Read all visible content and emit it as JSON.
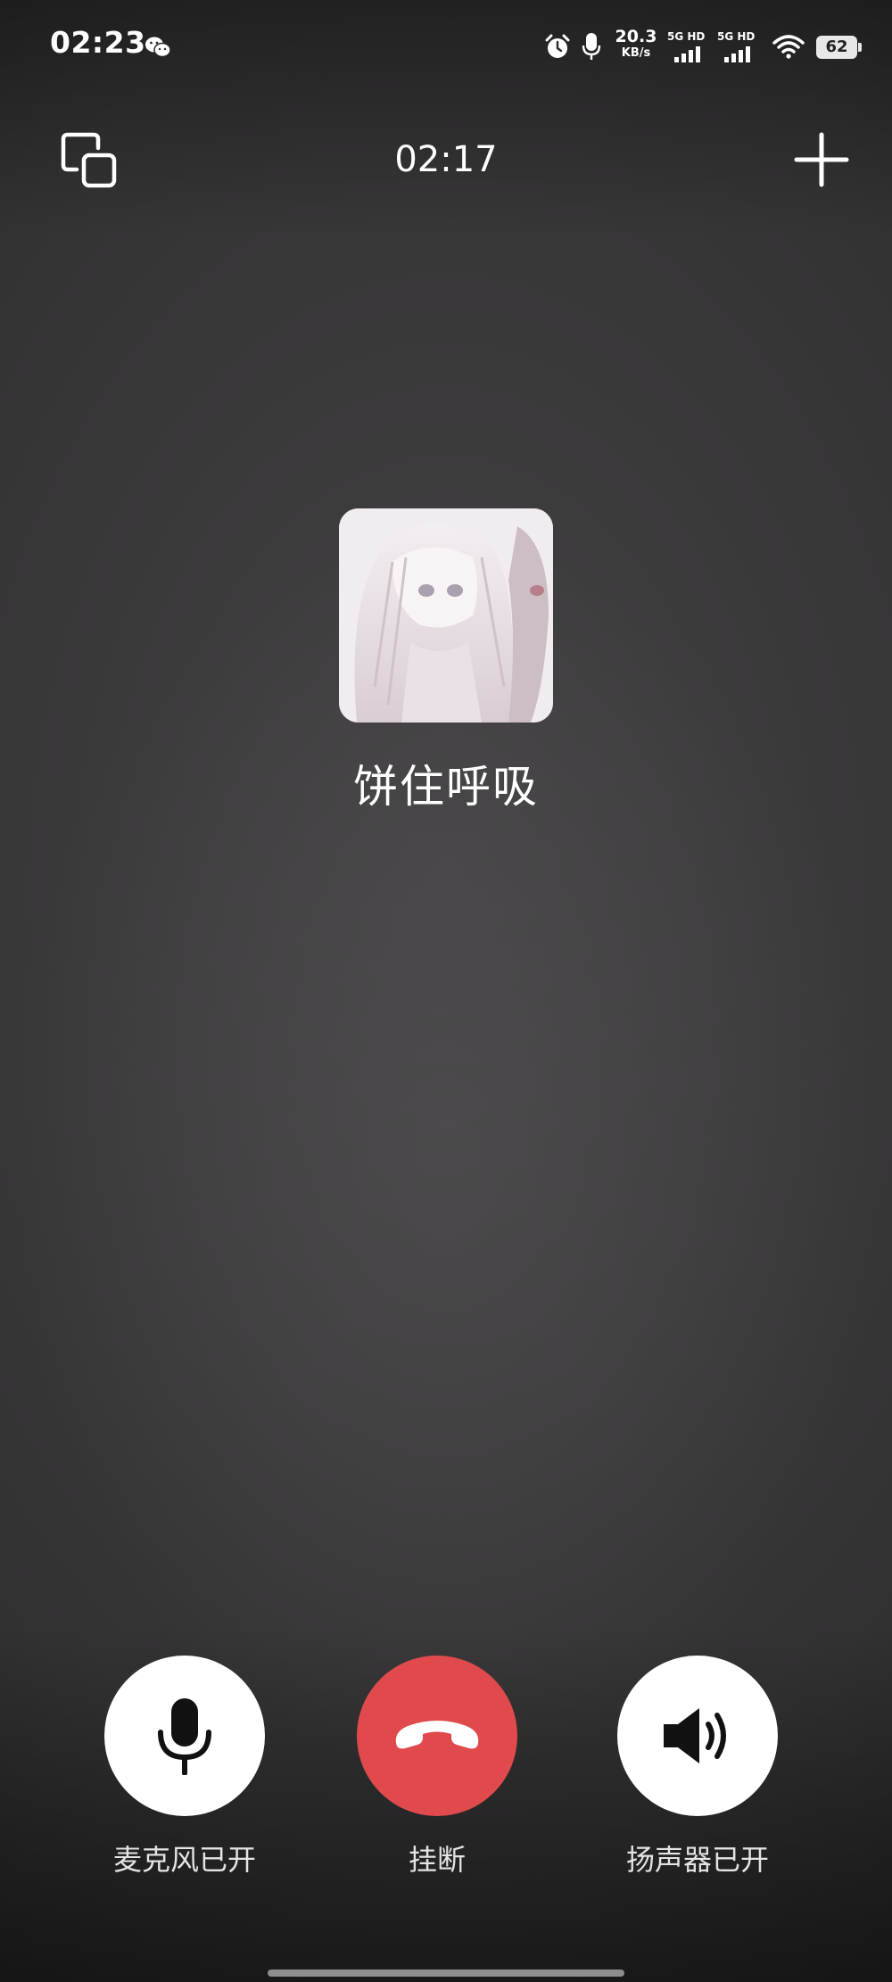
{
  "status_bar": {
    "time": "02:23",
    "net_speed_value": "20.3",
    "net_speed_unit": "KB/s",
    "sim1_label": "5G HD",
    "sim2_label": "5G HD",
    "battery_level": "62",
    "icons": [
      "wechat-icon",
      "alarm-icon",
      "microphone-icon",
      "signal-icon",
      "wifi-icon",
      "battery-icon"
    ]
  },
  "call": {
    "duration": "02:17",
    "contact_name": "饼住呼吸",
    "icons": {
      "float_window": "float-window-icon",
      "add": "plus-icon"
    }
  },
  "controls": {
    "microphone_label": "麦克风已开",
    "hangup_label": "挂断",
    "speaker_label": "扬声器已开",
    "hangup_color": "#e04a4c"
  }
}
